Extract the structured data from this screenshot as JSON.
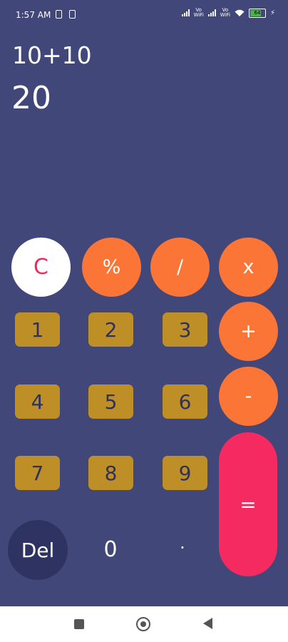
{
  "status_bar": {
    "time": "1:57 AM",
    "vowifi_label_1": "Vo\nWiFi",
    "vowifi_label_2": "Vo\nWiFi",
    "battery": "64"
  },
  "display": {
    "expression": "10+10",
    "result": "20"
  },
  "keypad": {
    "clear": "C",
    "percent": "%",
    "divide": "/",
    "multiply": "x",
    "plus": "+",
    "minus": "-",
    "equals": "=",
    "one": "1",
    "two": "2",
    "three": "3",
    "four": "4",
    "five": "5",
    "six": "6",
    "seven": "7",
    "eight": "8",
    "nine": "9",
    "delete": "Del",
    "zero": "0",
    "dot": "."
  },
  "colors": {
    "background": "#42477a",
    "operator": "#fb7536",
    "digit": "#bd8f26",
    "equals": "#f42a60",
    "delete": "#2f3361"
  }
}
